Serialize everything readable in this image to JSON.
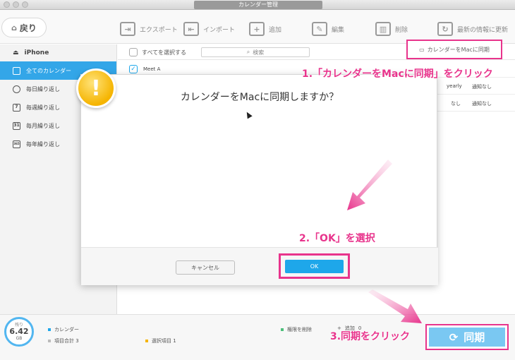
{
  "window": {
    "title": "カレンダー管理"
  },
  "toolbar": {
    "back_label": "戻り",
    "export_label": "エクスポート",
    "import_label": "インポート",
    "add_label": "追加",
    "edit_label": "編集",
    "delete_label": "削除",
    "refresh_label": "最新の情報に更新"
  },
  "sidebar": {
    "device": "iPhone",
    "items": [
      {
        "label": "全てのカレンダー",
        "icon": "calendar-icon",
        "active": true
      },
      {
        "label": "毎日繰り返し",
        "icon": "clock-icon"
      },
      {
        "label": "毎週繰り返し",
        "icon": "calendar-7-icon",
        "num": "7"
      },
      {
        "label": "毎月繰り返し",
        "icon": "calendar-31-icon",
        "num": "31"
      },
      {
        "label": "毎年繰り返し",
        "icon": "calendar-365-icon",
        "num": "365"
      }
    ]
  },
  "main": {
    "select_all": "すべてを選択する",
    "search_placeholder": "検索",
    "sync_mac_label": "カレンダーをMacに同期",
    "rows": [
      {
        "title": "Meet A",
        "checked": true,
        "repeat": "",
        "alert": ""
      },
      {
        "title": "",
        "checked": false,
        "repeat": "yearly",
        "alert": "通知なし"
      },
      {
        "title": "",
        "checked": false,
        "repeat": "なし",
        "alert": "通知なし"
      }
    ]
  },
  "dialog": {
    "message": "カレンダーをMacに同期しますか？",
    "cancel_label": "キャンセル",
    "ok_label": "OK"
  },
  "footer": {
    "storage_label": "残り",
    "storage_value": "6.42",
    "storage_unit": "GB",
    "legend": [
      {
        "label": "カレンダー",
        "color": "#1ea7ea"
      },
      {
        "label": "項目合計 3",
        "color": "#bbbbbb"
      },
      {
        "label": "選択項目 1",
        "color": "#f5b400"
      },
      {
        "label": "権限を削除",
        "color": "#4cbf7a"
      }
    ],
    "add_label": "追加",
    "add_count": "0",
    "sync_label": "同期"
  },
  "annotations": {
    "step1": "1.「カレンダーをMacに同期」をクリック",
    "step2": "2.「OK」を選択",
    "step3": "3.同期をクリック"
  },
  "colors": {
    "accent": "#1ea7ea",
    "highlight": "#e8348c",
    "warning": "#f5b400"
  }
}
